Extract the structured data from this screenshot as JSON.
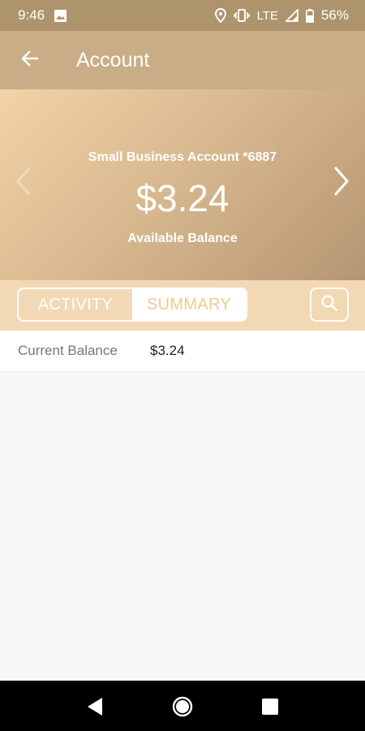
{
  "status_bar": {
    "time": "9:46",
    "network": "LTE",
    "battery": "56%",
    "icons": [
      "image-icon",
      "location-icon",
      "vibrate-icon",
      "signal-icon",
      "battery-icon"
    ]
  },
  "app_bar": {
    "title": "Account",
    "back_icon": "arrow-back-icon"
  },
  "account": {
    "name": "Small Business Account *6887",
    "balance": "$3.24",
    "balance_label": "Available Balance"
  },
  "tabs": {
    "activity": "ACTIVITY",
    "summary": "SUMMARY",
    "selected": "SUMMARY"
  },
  "summary": {
    "rows": [
      {
        "label": "Current Balance",
        "value": "$3.24"
      }
    ]
  },
  "colors": {
    "status_bar": "#ad946c",
    "app_bar": "#c9ad86",
    "tab_bar": "#f2d8b4",
    "accent_text": "#f0c98f"
  },
  "nav": {
    "icons": [
      "back-triangle-icon",
      "home-circle-icon",
      "recents-square-icon"
    ]
  }
}
